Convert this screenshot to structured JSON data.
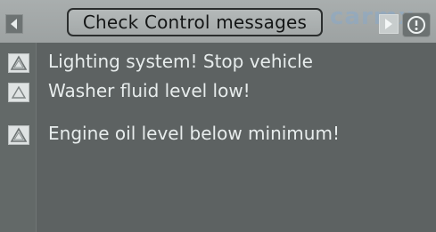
{
  "header": {
    "title": "Check Control messages",
    "watermark": "carmx"
  },
  "messages": [
    {
      "text": "Lighting system! Stop vehicle",
      "icon": "warning-triangle-icon"
    },
    {
      "text": "Washer fluid level low!",
      "icon": "warning-triangle-icon"
    },
    {
      "text": "Engine oil level below minimum!",
      "icon": "warning-triangle-icon"
    }
  ],
  "colors": {
    "header_bg": "#a3a8a8",
    "screen_bg": "#5b605f",
    "text": "#e7ecec",
    "title_text": "#141616"
  }
}
